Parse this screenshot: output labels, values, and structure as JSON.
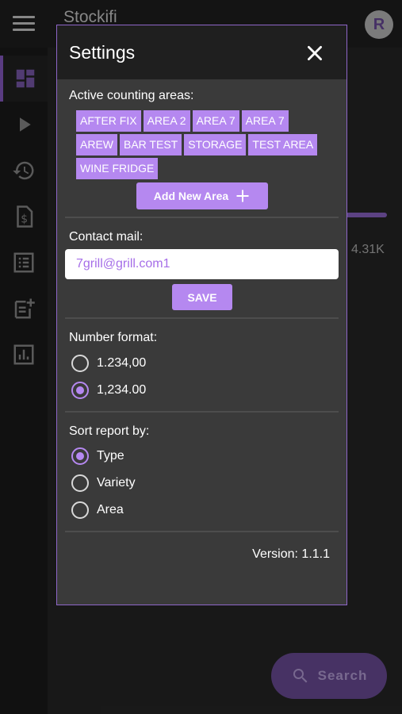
{
  "app": {
    "title": "Stockifi",
    "avatar_initial": "R",
    "accent_color": "#b588f0",
    "nav_items": [
      {
        "name": "dashboard",
        "icon": "dashboard-icon",
        "active": true
      },
      {
        "name": "play",
        "icon": "play-icon"
      },
      {
        "name": "history",
        "icon": "history-icon"
      },
      {
        "name": "invoices",
        "icon": "invoice-dollar-icon"
      },
      {
        "name": "list",
        "icon": "list-icon"
      },
      {
        "name": "add-note",
        "icon": "add-note-icon"
      },
      {
        "name": "reports",
        "icon": "bar-chart-icon"
      }
    ],
    "background_stat": "4.31K",
    "search_fab_label": "Search"
  },
  "settings": {
    "title": "Settings",
    "areas_label": "Active counting areas:",
    "areas": [
      "AFTER FIX",
      "AREA 2",
      "AREA 7",
      "AREA 7",
      "AREW",
      "BAR TEST",
      "STORAGE",
      "TEST AREA",
      "WINE FRIDGE"
    ],
    "add_area_label": "Add New Area",
    "contact_label": "Contact mail:",
    "contact_value": "7grill@grill.com1",
    "save_label": "SAVE",
    "number_format_label": "Number format:",
    "number_formats": [
      {
        "label": "1.234,00",
        "checked": false
      },
      {
        "label": "1,234.00",
        "checked": true
      }
    ],
    "sort_label": "Sort report by:",
    "sort_options": [
      {
        "label": "Type",
        "checked": true
      },
      {
        "label": "Variety",
        "checked": false
      },
      {
        "label": "Area",
        "checked": false
      }
    ],
    "version": "Version: 1.1.1"
  }
}
